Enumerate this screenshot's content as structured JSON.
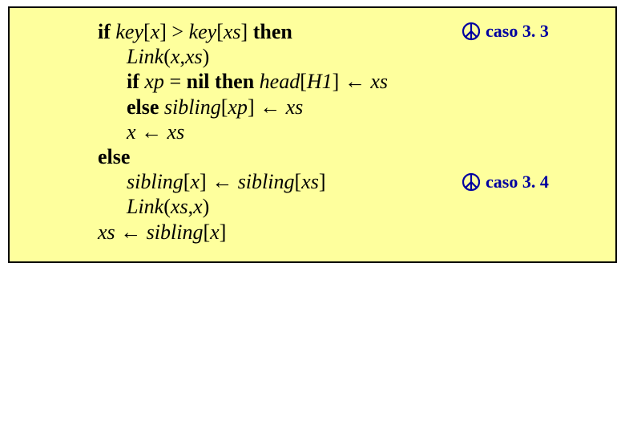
{
  "code": {
    "l1_if": "if ",
    "l1_keyx": "key",
    "l1_lbr1": "[",
    "l1_x": "x",
    "l1_rbr1": "] > ",
    "l1_keyxs": "key",
    "l1_lbr2": "[",
    "l1_xs": "xs",
    "l1_rbr2": "] ",
    "l1_then": "then",
    "l2_link": "Link",
    "l2_open": "(",
    "l2_x": "x",
    "l2_comma": ",",
    "l2_xs": "xs",
    "l2_close": ")",
    "l3_if": "if ",
    "l3_xp": "xp ",
    "l3_eq": "= ",
    "l3_nil": "nil ",
    "l3_then": "then ",
    "l3_head": "head",
    "l3_lbr": "[",
    "l3_h1": "H1",
    "l3_rbr": "] ",
    "l3_arrow": "← ",
    "l3_xs": "xs",
    "l4_else": "else ",
    "l4_sibling": "sibling",
    "l4_lbr": "[",
    "l4_xp": "xp",
    "l4_rbr": "] ",
    "l4_arrow": "← ",
    "l4_xs": "xs",
    "l5_x": "x ",
    "l5_arrow": "← ",
    "l5_xs": "xs",
    "l6_else": "else",
    "l7_sibling1": "sibling",
    "l7_lbr1": "[",
    "l7_x": "x",
    "l7_rbr1": "] ",
    "l7_arrow": "← ",
    "l7_sibling2": "sibling",
    "l7_lbr2": "[",
    "l7_xs": "xs",
    "l7_rbr2": "]",
    "l8_link": "Link",
    "l8_open": "(",
    "l8_xs": "xs",
    "l8_comma": ",",
    "l8_x": "x",
    "l8_close": ")",
    "l9_xs": "xs ",
    "l9_arrow": "← ",
    "l9_sibling": "sibling",
    "l9_lbr": "[",
    "l9_x": "x",
    "l9_rbr": "]"
  },
  "annotations": {
    "a1_label": "caso 3. 3",
    "a2_label": "caso 3. 4"
  },
  "colors": {
    "panel_bg": "#feff9d",
    "border": "#000000",
    "text": "#000000",
    "annot": "#0000a0"
  }
}
